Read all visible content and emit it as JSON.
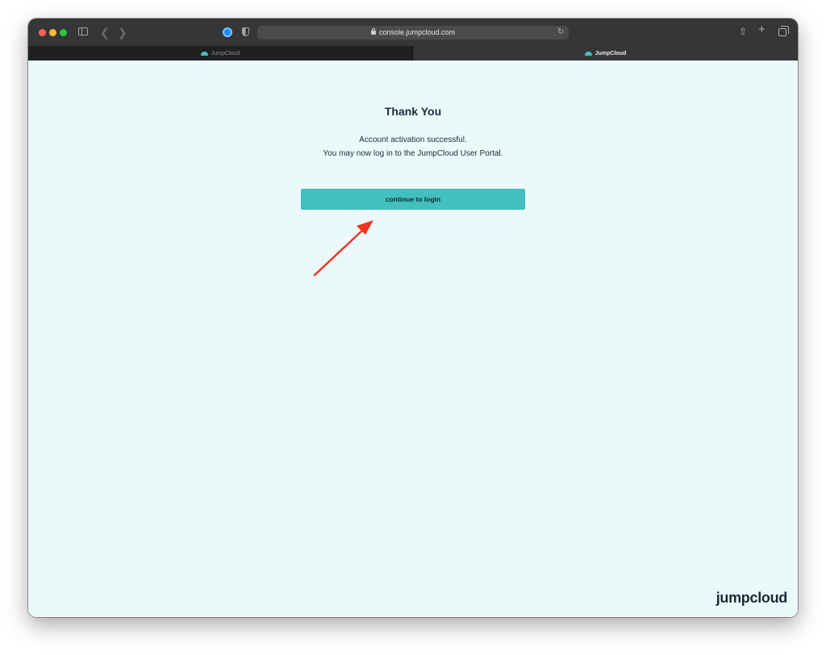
{
  "browser": {
    "url": "console.jumpcloud.com",
    "tabs": [
      {
        "label": "JumpCloud",
        "active": false
      },
      {
        "label": "JumpCloud",
        "active": true
      }
    ]
  },
  "page": {
    "title": "Thank You",
    "message_line1": "Account activation successful.",
    "message_line2": "You may now log in to the JumpCloud User Portal.",
    "button_label": "continue to login",
    "brand": "jumpcloud"
  },
  "colors": {
    "accent": "#41c0bd",
    "background": "#ebf9fb",
    "annotation_arrow": "#f0341f"
  }
}
